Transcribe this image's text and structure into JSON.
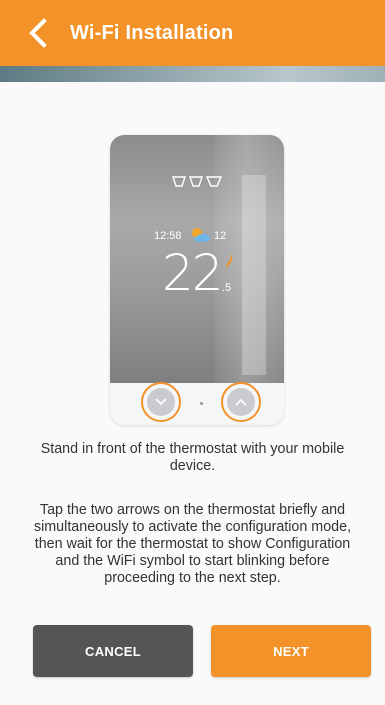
{
  "header": {
    "title": "Wi-Fi Installation",
    "back_icon": "chevron-left-icon",
    "accent_color": "#f39229"
  },
  "device": {
    "clock": "12:58",
    "outdoor_temp": "12",
    "temperature": "22",
    "temperature_decimal": ".5",
    "weather_icon": "partly-cloudy-icon",
    "down_arrow_icon": "chevron-down-icon",
    "up_arrow_icon": "chevron-up-icon"
  },
  "instructions": {
    "line1": "Stand in front of the thermostat with your mobile device.",
    "line2": "Tap the two arrows on the thermostat briefly and simultaneously to activate the configuration mode, then wait for the thermostat to show Configuration and the WiFi symbol to start blinking before proceeding to the next step."
  },
  "buttons": {
    "cancel": "CANCEL",
    "next": "NEXT",
    "cancel_color": "#555555",
    "next_color": "#f39229"
  }
}
